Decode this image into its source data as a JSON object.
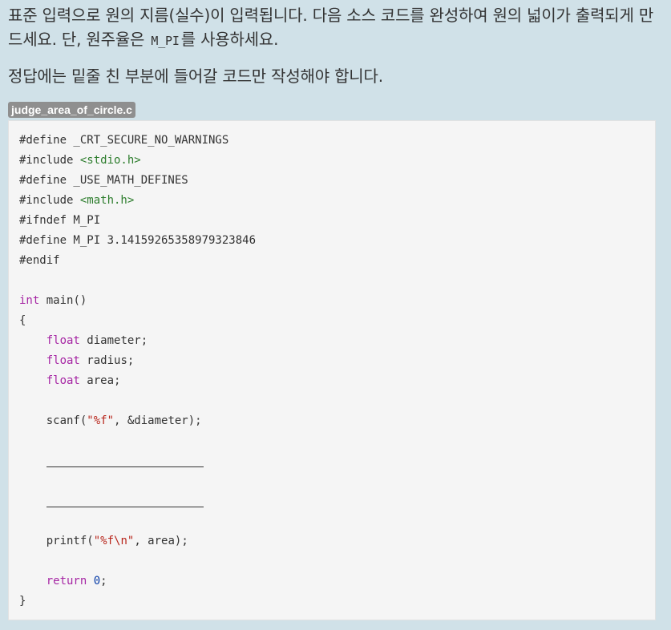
{
  "problem": {
    "para1_a": "표준 입력으로 원의 지름(실수)이 입력됩니다. 다음 소스 코드를 완성하여 원의 넓이가 출력되게 만드세요. 단, 원주율은 ",
    "para1_code": "M_PI",
    "para1_b": "를 사용하세요.",
    "para2": "정답에는 밑줄 친 부분에 들어갈 코드만 작성해야 합니다."
  },
  "file": {
    "name": "judge_area_of_circle.c"
  },
  "code": {
    "l1": "#define _CRT_SECURE_NO_WARNINGS",
    "l2_pre": "#include ",
    "l2_inc": "<stdio.h>",
    "l3": "#define _USE_MATH_DEFINES",
    "l4_pre": "#include ",
    "l4_inc": "<math.h>",
    "l5": "#ifndef M_PI",
    "l6": "#define M_PI 3.14159265358979323846",
    "l7": "#endif",
    "l9_kw": "int",
    "l9_rest": " main()",
    "l10": "{",
    "l11_kw": "float",
    "l11_rest": " diameter;",
    "l12_kw": "float",
    "l12_rest": " radius;",
    "l13_kw": "float",
    "l13_rest": " area;",
    "l15_a": "scanf(",
    "l15_str": "\"%f\"",
    "l15_b": ", &diameter);",
    "l21_a": "printf(",
    "l21_str": "\"%f\\n\"",
    "l21_b": ", area);",
    "l23_kw": "return",
    "l23_num": "0",
    "l23_b": ";",
    "l24": "}"
  }
}
